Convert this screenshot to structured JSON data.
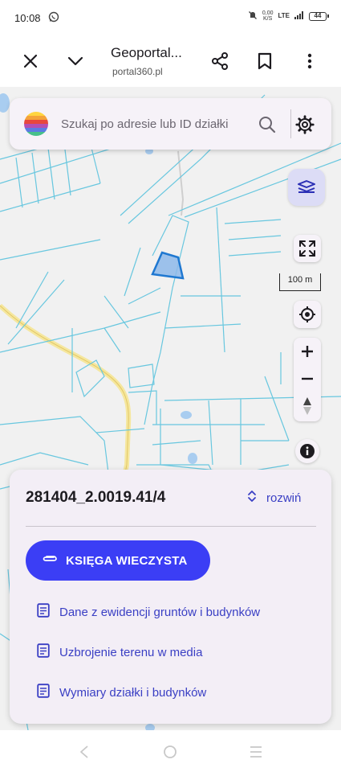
{
  "status_bar": {
    "time": "10:08",
    "speed_value": "0,00",
    "speed_unit": "K/S",
    "network": "LTE",
    "battery": "44"
  },
  "browser": {
    "title": "Geoportal...",
    "url": "portal360.pl"
  },
  "search": {
    "placeholder": "Szukaj po adresie lub ID działki"
  },
  "map": {
    "scale_label": "100 m",
    "accent_color": "#3b3ef5",
    "selection_color": "#1f78d1"
  },
  "parcel": {
    "id": "281404_2.0019.41/4",
    "expand_label": "rozwiń",
    "primary_button": "KSIĘGA WIECZYSTA",
    "links": [
      "Dane z ewidencji gruntów i budynków",
      "Uzbrojenie terenu w media",
      "Wymiary działki i budynków"
    ]
  }
}
